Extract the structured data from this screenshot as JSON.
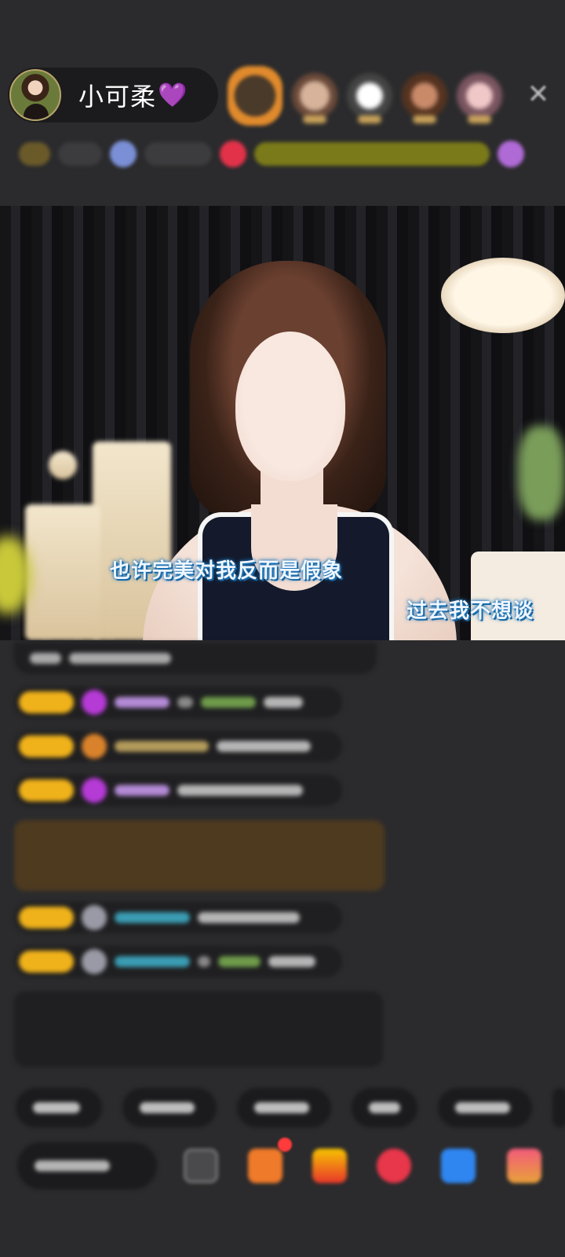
{
  "host": {
    "name": "小可柔",
    "badge_icon": "purple-heart-icon",
    "heart_glyph": "💜"
  },
  "top_viewers": [
    {
      "icon": "viewer-avatar",
      "ring_color": "#e08a2c"
    },
    {
      "icon": "viewer-avatar"
    },
    {
      "icon": "viewer-avatar"
    },
    {
      "icon": "viewer-avatar"
    },
    {
      "icon": "viewer-avatar"
    }
  ],
  "close_glyph": "✕",
  "stream": {
    "lyrics": [
      "也许完美对我反而是假象",
      "过去我不想谈"
    ],
    "lyric_color": "#1b73b5"
  },
  "colors": {
    "background": "#2b2b2d",
    "pill": "#1b1b1d",
    "level_badge": "#f0b21a",
    "gift_row": "#4e3a1f"
  }
}
